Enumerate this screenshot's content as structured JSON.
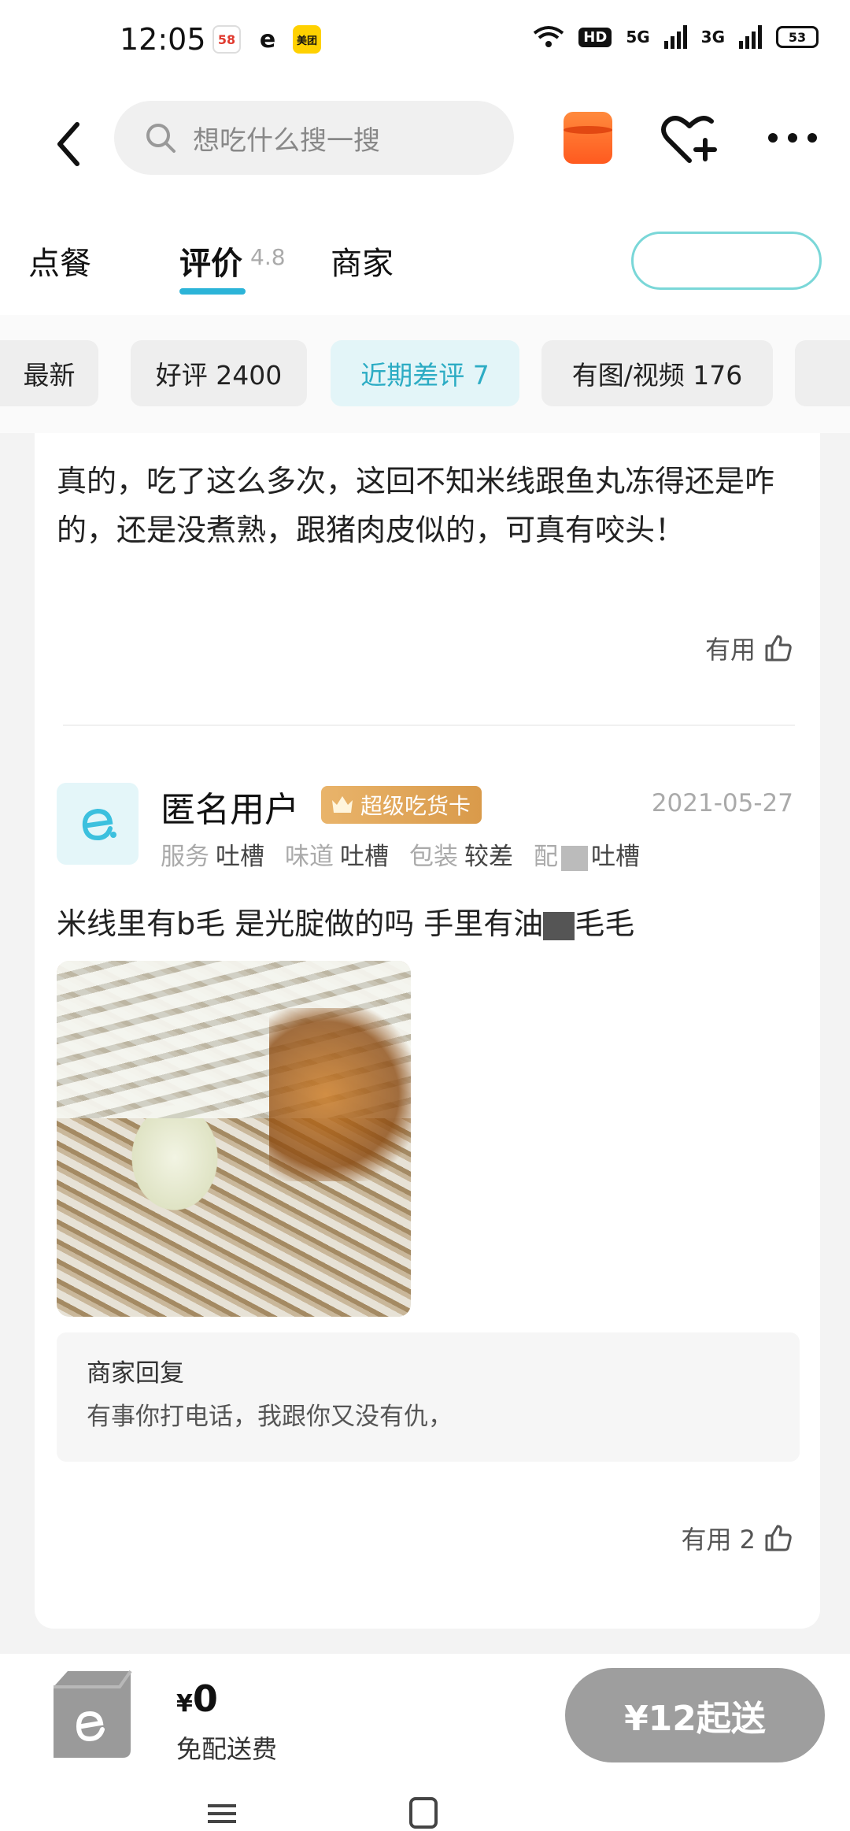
{
  "status_bar": {
    "time": "12:05",
    "apps": [
      "58",
      "e",
      "美团"
    ],
    "hd": "HD",
    "network1": "5G",
    "network2": "3G",
    "battery": "53"
  },
  "nav": {
    "search_placeholder": "想吃什么搜一搜"
  },
  "tabs": {
    "order": "点餐",
    "review": "评价",
    "review_score": "4.8",
    "merchant": "商家"
  },
  "filters": {
    "latest": "最新",
    "good": "好评 2400",
    "bad_recent": "近期差评 7",
    "media": "有图/视频 176"
  },
  "review1": {
    "text": "真的，吃了这么多次，这回不知米线跟鱼丸冻得还是咋的，还是没煮熟，跟猪肉皮似的，可真有咬头！",
    "useful": "有用"
  },
  "review2": {
    "username": "匿名用户",
    "badge": "超级吃货卡",
    "date": "2021-05-27",
    "ratings": [
      {
        "k": "服务",
        "v": "吐槽"
      },
      {
        "k": "味道",
        "v": "吐槽"
      },
      {
        "k": "包装",
        "v": "较差"
      },
      {
        "k": "配",
        "v": "吐槽"
      }
    ],
    "text_before": "米线里有b毛 是光腚做的吗 手里有油",
    "text_after": "毛毛",
    "reply_title": "商家回复",
    "reply_text": "有事你打电话，我跟你又没有仇，",
    "useful": "有用 2"
  },
  "cart": {
    "currency": "¥",
    "price": "0",
    "fee": "免配送费",
    "checkout": "¥12起送"
  },
  "colors": {
    "accent": "#2cb4d8",
    "badge": "#e0a65a",
    "checkout_bg": "#9e9e9e"
  }
}
